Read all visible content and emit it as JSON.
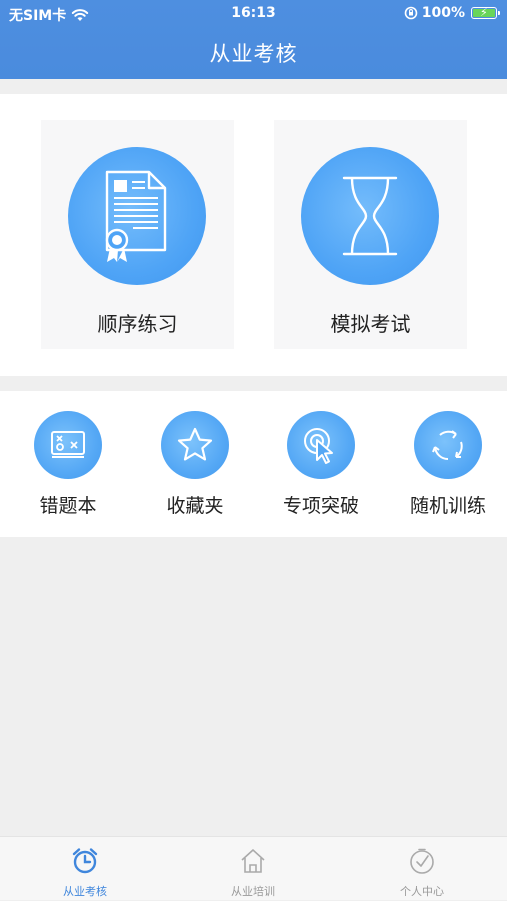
{
  "status_bar": {
    "carrier": "无SIM卡",
    "time": "16:13",
    "battery_percent": "100%"
  },
  "header": {
    "title": "从业考核"
  },
  "main_tiles": [
    {
      "label": "顺序练习",
      "icon": "certificate-document-icon"
    },
    {
      "label": "模拟考试",
      "icon": "hourglass-icon"
    }
  ],
  "sub_items": [
    {
      "label": "错题本",
      "icon": "wrong-questions-board-icon"
    },
    {
      "label": "收藏夹",
      "icon": "star-icon"
    },
    {
      "label": "专项突破",
      "icon": "target-cursor-icon"
    },
    {
      "label": "随机训练",
      "icon": "refresh-cycle-icon"
    }
  ],
  "tab_bar": {
    "tabs": [
      {
        "label": "从业考核",
        "icon": "alarm-clock-icon",
        "active": true
      },
      {
        "label": "从业培训",
        "icon": "house-icon",
        "active": false
      },
      {
        "label": "个人中心",
        "icon": "check-clock-icon",
        "active": false
      }
    ]
  },
  "colors": {
    "header_blue": "#4a8bdd",
    "icon_blue": "#55a8f5",
    "active_tab": "#3f86dc",
    "inactive_tab": "#999999"
  }
}
